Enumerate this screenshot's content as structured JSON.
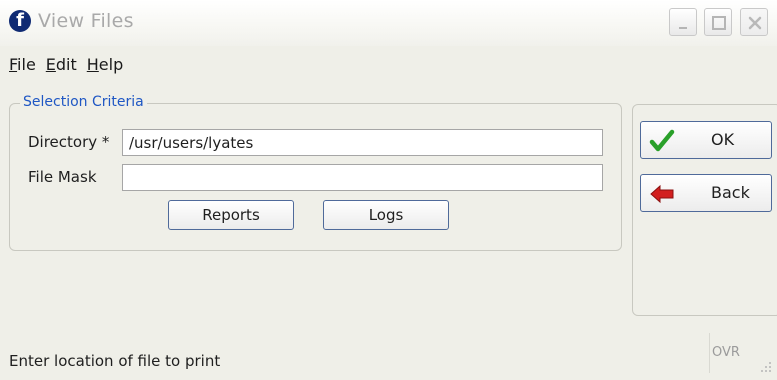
{
  "window": {
    "title": "View Files",
    "app_icon_glyph": "f",
    "controls": {
      "minimize": "minimize-icon",
      "maximize": "maximize-icon",
      "close": "close-icon"
    }
  },
  "menu": {
    "items": [
      {
        "accel": "F",
        "rest": "ile"
      },
      {
        "accel": "E",
        "rest": "dit"
      },
      {
        "accel": "H",
        "rest": "elp"
      }
    ]
  },
  "selection": {
    "legend": "Selection Criteria",
    "directory": {
      "label": "Directory *",
      "value": "/usr/users/lyates"
    },
    "file_mask": {
      "label": "File Mask",
      "value": ""
    },
    "buttons": {
      "reports": "Reports",
      "logs": "Logs"
    }
  },
  "actions": {
    "ok": {
      "label": "OK",
      "icon": "checkmark-icon",
      "icon_color": "#2aa02a"
    },
    "back": {
      "label": "Back",
      "icon": "back-arrow-icon",
      "icon_color": "#d21f1f"
    }
  },
  "status": {
    "message": "Enter location of file to print",
    "mode": "OVR"
  }
}
